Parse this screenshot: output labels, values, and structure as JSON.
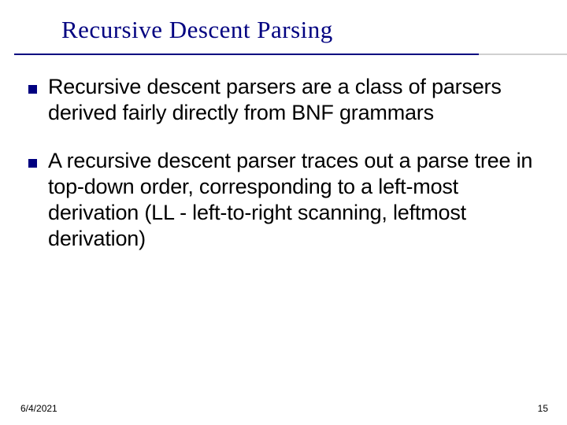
{
  "slide": {
    "title": "Recursive Descent Parsing",
    "bullets": [
      "Recursive descent parsers are a class of parsers derived fairly directly from BNF grammars",
      "A recursive descent parser traces out a parse tree in top-down order, corresponding to a left-most derivation (LL - left-to-right scanning, leftmost derivation)"
    ]
  },
  "footer": {
    "date": "6/4/2021",
    "page": "15"
  }
}
